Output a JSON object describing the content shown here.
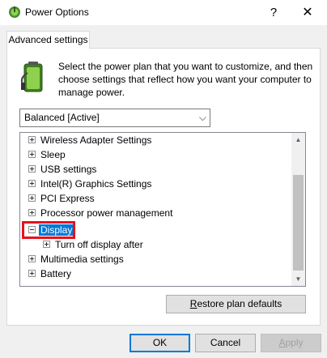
{
  "window": {
    "title": "Power Options",
    "help_label": "?",
    "close_label": "✕"
  },
  "tab": {
    "label": "Advanced settings"
  },
  "description": "Select the power plan that you want to customize, and then choose settings that reflect how you want your computer to manage power.",
  "plan_select": {
    "value": "Balanced [Active]",
    "chevron": "⌵"
  },
  "tree": {
    "items": [
      {
        "label": "Wireless Adapter Settings",
        "state": "collapsed"
      },
      {
        "label": "Sleep",
        "state": "collapsed"
      },
      {
        "label": "USB settings",
        "state": "collapsed"
      },
      {
        "label": "Intel(R) Graphics Settings",
        "state": "collapsed"
      },
      {
        "label": "PCI Express",
        "state": "collapsed"
      },
      {
        "label": "Processor power management",
        "state": "collapsed"
      },
      {
        "label": "Display",
        "state": "expanded",
        "selected": true
      },
      {
        "label": "Turn off display after",
        "state": "collapsed",
        "child": true
      },
      {
        "label": "Multimedia settings",
        "state": "collapsed"
      },
      {
        "label": "Battery",
        "state": "collapsed"
      }
    ]
  },
  "buttons": {
    "restore_prefix": "",
    "restore_accel": "R",
    "restore_rest": "estore plan defaults",
    "ok": "OK",
    "cancel": "Cancel",
    "apply_accel": "A",
    "apply_rest": "pply"
  },
  "colors": {
    "selection": "#0078d7",
    "highlight_box": "#e8111b"
  }
}
